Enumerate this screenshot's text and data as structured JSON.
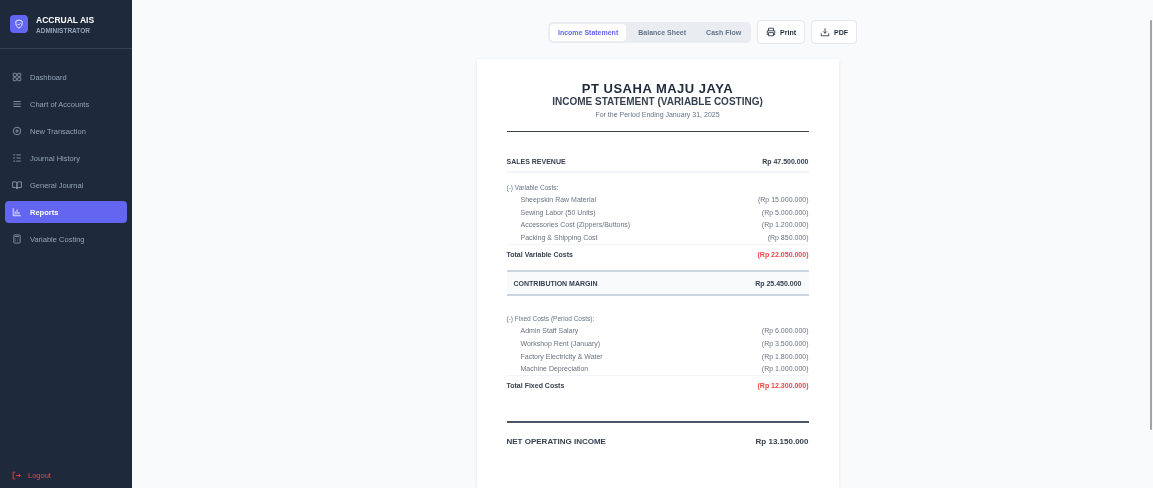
{
  "sidebar": {
    "app_name": "ACCRUAL AIS",
    "role": "ADMINISTRATOR",
    "items": [
      {
        "label": "Dashboard",
        "selected": false
      },
      {
        "label": "Chart of Accounts",
        "selected": false
      },
      {
        "label": "New Transaction",
        "selected": false
      },
      {
        "label": "Journal History",
        "selected": false
      },
      {
        "label": "General Journal",
        "selected": false
      },
      {
        "label": "Reports",
        "selected": true
      },
      {
        "label": "Variable Costing",
        "selected": false
      }
    ],
    "logout": "Logout"
  },
  "tabs": [
    {
      "label": "Income Statement",
      "selected": true
    },
    {
      "label": "Balance Sheet",
      "selected": false
    },
    {
      "label": "Cash Flow",
      "selected": false
    }
  ],
  "actions": [
    {
      "label": "Print"
    },
    {
      "label": "PDF"
    }
  ],
  "report": {
    "company": "PT USAHA MAJU JAYA",
    "title": "INCOME STATEMENT (VARIABLE COSTING)",
    "period": "For the Period Ending January 31, 2025",
    "rows": [
      {
        "kind": "header",
        "label": "SALES REVENUE",
        "amount": "Rp 47.500.000"
      },
      {
        "kind": "group",
        "label": "(-) Variable Costs:"
      },
      {
        "kind": "item",
        "label": "Sheepskin Raw Material",
        "amount": "(Rp 15.000.000)"
      },
      {
        "kind": "item",
        "label": "Sewing Labor (50 Units)",
        "amount": "(Rp 5.000.000)"
      },
      {
        "kind": "item",
        "label": "Accessories Cost (Zippers/Buttons)",
        "amount": "(Rp 1.200.000)"
      },
      {
        "kind": "item",
        "label": "Packing & Shipping Cost",
        "amount": "(Rp 850.000)"
      },
      {
        "kind": "total",
        "label": "Total Variable Costs",
        "amount": "(Rp 22.050.000)"
      },
      {
        "kind": "margin",
        "label": "CONTRIBUTION MARGIN",
        "amount": "Rp 25.450.000"
      },
      {
        "kind": "group",
        "label": "(-) Fixed Costs (Period Costs):"
      },
      {
        "kind": "item",
        "label": "Admin Staff Salary",
        "amount": "(Rp 6.000.000)"
      },
      {
        "kind": "item",
        "label": "Workshop Rent (January)",
        "amount": "(Rp 3.500.000)"
      },
      {
        "kind": "item",
        "label": "Factory Electricity & Water",
        "amount": "(Rp 1.800.000)"
      },
      {
        "kind": "item",
        "label": "Machine Depreciation",
        "amount": "(Rp 1.000.000)"
      },
      {
        "kind": "total",
        "label": "Total Fixed Costs",
        "amount": "(Rp 12.300.000)"
      },
      {
        "kind": "net",
        "label": "NET OPERATING INCOME",
        "amount": "Rp 13.150.000"
      }
    ]
  }
}
